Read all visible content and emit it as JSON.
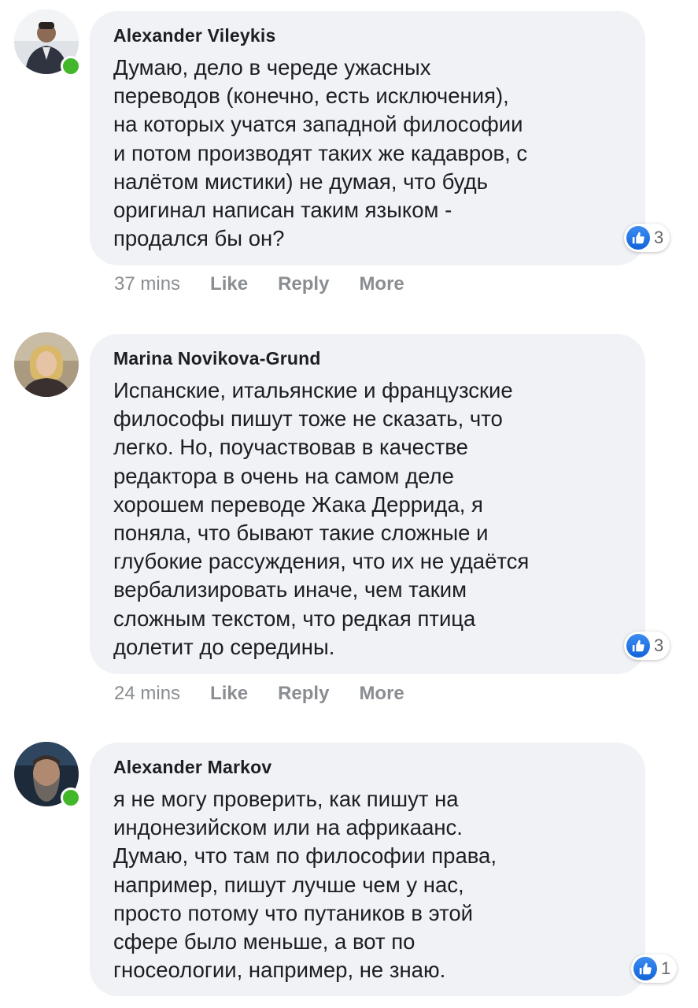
{
  "comments": [
    {
      "author": "Alexander Vileykis",
      "text": "Думаю, дело в череде ужасных\nпереводов (конечно, есть исключения),\nна которых учатся западной философии\nи потом производят таких же кадавров, с\nналётом мистики) не думая, что будь\nоригинал написан таким языком -\nпродался бы он?",
      "reactions": "3",
      "time": "37 mins",
      "online": true
    },
    {
      "author": "Marina Novikova-Grund",
      "text": "Испанские, итальянские и французские\nфилософы пишут тоже не сказать, что\nлегко. Но, поучаствовав в качестве\nредактора в очень на самом деле\nхорошем переводе Жака Деррида, я\nпоняла, что бывают такие сложные и\nглубокие рассуждения, что их не удаётся\nвербализировать иначе, чем таким\nсложным текстом, что редкая птица\nдолетит до середины.",
      "reactions": "3",
      "time": "24 mins",
      "online": false
    },
    {
      "author": "Alexander Markov",
      "text": "я не могу проверить, как пишут на\nиндонезийском или на африкаанс.\nДумаю, что там по философии права,\nнапример, пишут лучше чем у нас,\nпросто потому что путаников в этой\nсфере было меньше, а вот по\nгносеологии, например, не знаю.",
      "reactions": "1",
      "online": true
    }
  ],
  "actions": {
    "like": "Like",
    "reply": "Reply",
    "more": "More"
  },
  "colors": {
    "bubble": "#f0f2f5",
    "online": "#42b72a",
    "like_blue": "#1877f2",
    "meta_text": "#8a8d91"
  }
}
